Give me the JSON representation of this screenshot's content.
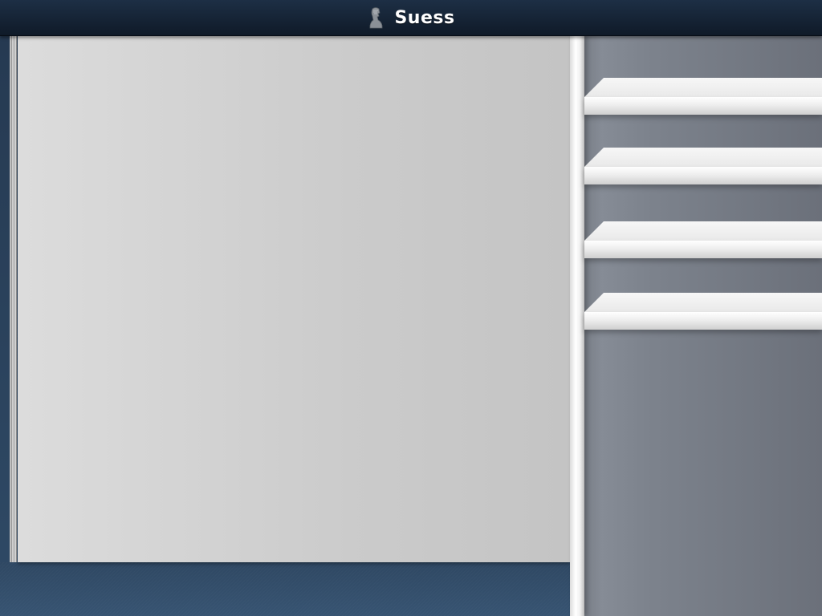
{
  "title_bar": {
    "title": "Suess",
    "icon": "bust-statue-icon"
  },
  "main": {
    "reader_page": {
      "content": ""
    }
  },
  "bookshelf": {
    "shelf_count": 4,
    "shelves": [
      {
        "items": []
      },
      {
        "items": []
      },
      {
        "items": []
      },
      {
        "items": []
      }
    ]
  },
  "colors": {
    "title_bar": "#132235",
    "background": "#2f4863",
    "paper": "#d2d2d2",
    "shelf": "#f2f2f2",
    "bookshelf_back": "#787e88"
  }
}
